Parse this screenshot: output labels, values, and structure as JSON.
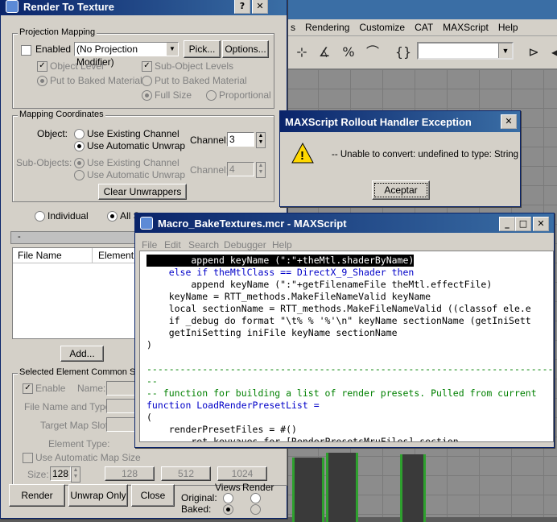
{
  "max": {
    "menus": [
      "s",
      "Rendering",
      "Customize",
      "CAT",
      "MAXScript",
      "Help"
    ]
  },
  "render_to_texture": {
    "title": "Render To Texture",
    "projection_mapping": {
      "label": "Projection Mapping",
      "enabled_label": "Enabled",
      "modifier_value": "(No Projection Modifier)",
      "pick_label": "Pick...",
      "options_label": "Options...",
      "object_level": "Object Level",
      "sub_object_levels": "Sub-Object Levels",
      "put_to_baked_material_1": "Put to Baked Material",
      "put_to_baked_material_2": "Put to Baked Material",
      "full_size": "Full Size",
      "proportional": "Proportional"
    },
    "mapping_coordinates": {
      "label": "Mapping Coordinates",
      "object_label": "Object:",
      "use_existing_channel": "Use Existing Channel",
      "use_automatic_unwrap": "Use Automatic Unwrap",
      "channel_label": "Channel:",
      "channel_value": "3",
      "sub_objects_label": "Sub-Objects:",
      "sub_use_existing_channel": "Use Existing Channel",
      "sub_use_automatic_unwrap": "Use Automatic Unwrap",
      "sub_channel_label": "Channel:",
      "sub_channel_value": "4",
      "clear_unwrappers_label": "Clear Unwrappers"
    },
    "individual_label": "Individual",
    "all_selected_label": "All S",
    "rollout_minus": "-",
    "output_columns": [
      "File Name",
      "Element N"
    ],
    "add_label": "Add...",
    "selected_element": {
      "label": "Selected Element Common Se",
      "enable_label": "Enable",
      "name_label": "Name:",
      "file_name_type_label": "File Name and Type:",
      "target_map_slot_label": "Target Map Slot:",
      "element_type_label": "Element Type:",
      "use_auto_map_size": "Use Automatic Map Size",
      "size_label": "Size:",
      "size_value": "128",
      "size_presets": [
        "128",
        "512",
        "1024"
      ]
    },
    "render_label": "Render",
    "unwrap_only_label": "Unwrap Only",
    "close_label": "Close",
    "original_label": "Original:",
    "baked_label": "Baked:",
    "views_label": "Views",
    "render_col_label": "Render"
  },
  "exception_dialog": {
    "title": "MAXScript Rollout Handler Exception",
    "message": "-- Unable to convert: undefined to type: String",
    "accept_label": "Aceptar",
    "warning_glyph": "!"
  },
  "editor": {
    "title": "Macro_BakeTextures.mcr - MAXScript",
    "menu": [
      "File",
      "Edit",
      "Search",
      "Debugger",
      "Help"
    ],
    "lines": [
      "        append keyName (\":\"+theMtl.shaderByName)",
      "    else if theMtlClass == DirectX_9_Shader then",
      "        append keyName (\":\"+getFilenameFile theMtl.effectFile)",
      "    keyName = RTT_methods.MakeFileNameValid keyName",
      "    local sectionName = RTT_methods.MakeFileNameValid ((classof ele.e",
      "    if _debug do format \"\\t% % '%'\\n\" keyName sectionName (getIniSett",
      "    getIniSetting iniFile keyName sectionName",
      ")",
      "",
      "--------------------------------------------------------------------------------------",
      "--",
      "-- function for building a list of render presets. Pulled from current",
      "function LoadRenderPresetList =",
      "(",
      "    renderPresetFiles = #()",
      "        ret keyvaues for [RenderPresetsMruFiles] section"
    ]
  }
}
